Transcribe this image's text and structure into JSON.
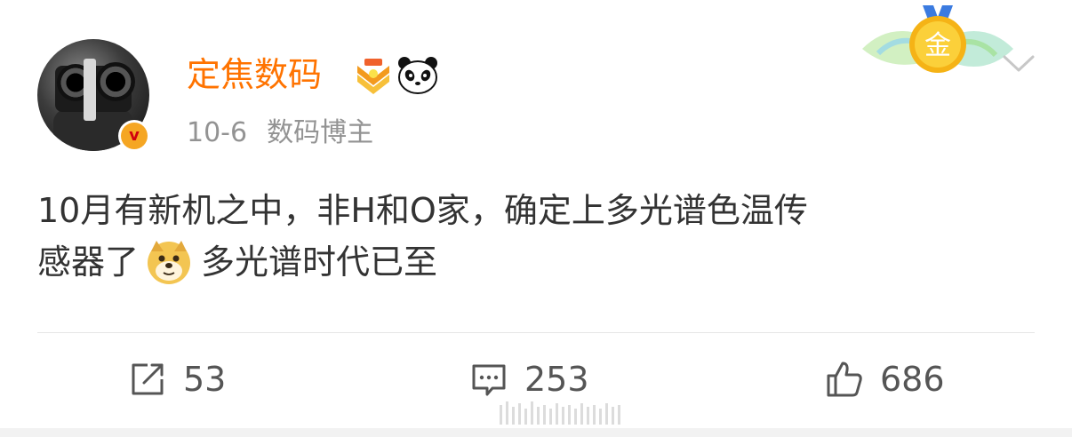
{
  "post": {
    "user": {
      "name": "定焦数码",
      "avatar_icon": "camera-photographer-avatar",
      "verified_badge": "v",
      "verified_icon": "verified-v-icon",
      "rank_icon": "rank-chevron-icon",
      "emblem_icon": "panda-icon"
    },
    "meta": {
      "date": "10-6",
      "tag": "数码博主"
    },
    "header_right": {
      "medal_icon": "gold-medal-icon",
      "medal_text": "金",
      "more_icon": "chevron-down-icon"
    },
    "content": {
      "line1": "10月有新机之中，非H和O家，确定上多光谱色温传",
      "line2_before": "感器了",
      "emoji": "doge-emoji",
      "line2_after": "多光谱时代已至"
    },
    "actions": {
      "repost": {
        "icon": "repost-icon",
        "count": "53"
      },
      "comment": {
        "icon": "comment-icon",
        "count": "253"
      },
      "like": {
        "icon": "thumbs-up-icon",
        "count": "686"
      }
    }
  },
  "colors": {
    "username": "#ff7300",
    "meta": "#939393",
    "text": "#333333",
    "divider": "#e6e6e6"
  }
}
